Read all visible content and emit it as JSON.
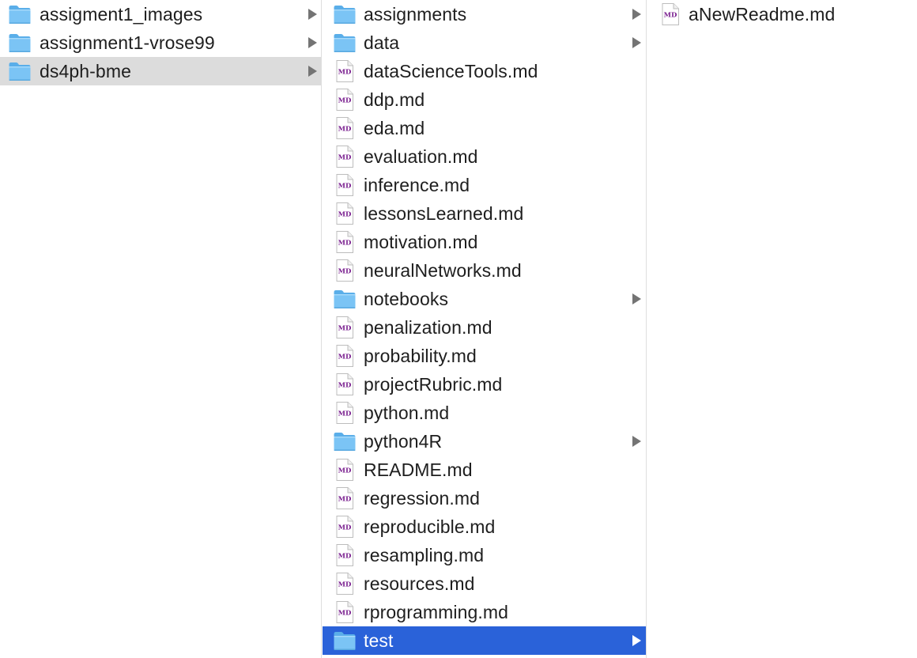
{
  "colors": {
    "active_selection": "#2a62d9",
    "inactive_selection": "#dcdcdc",
    "folder_blue": "#72c2f4",
    "md_badge": "#7a1f8f"
  },
  "columns": [
    {
      "name": "column-1",
      "items": [
        {
          "label": "assigment1_images",
          "kind": "folder",
          "selected": "none"
        },
        {
          "label": "assignment1-vrose99",
          "kind": "folder",
          "selected": "none"
        },
        {
          "label": "ds4ph-bme",
          "kind": "folder",
          "selected": "inactive"
        }
      ]
    },
    {
      "name": "column-2",
      "items": [
        {
          "label": "assignments",
          "kind": "folder",
          "selected": "none"
        },
        {
          "label": "data",
          "kind": "folder",
          "selected": "none"
        },
        {
          "label": "dataScienceTools.md",
          "kind": "md",
          "selected": "none"
        },
        {
          "label": "ddp.md",
          "kind": "md",
          "selected": "none"
        },
        {
          "label": "eda.md",
          "kind": "md",
          "selected": "none"
        },
        {
          "label": "evaluation.md",
          "kind": "md",
          "selected": "none"
        },
        {
          "label": "inference.md",
          "kind": "md",
          "selected": "none"
        },
        {
          "label": "lessonsLearned.md",
          "kind": "md",
          "selected": "none"
        },
        {
          "label": "motivation.md",
          "kind": "md",
          "selected": "none"
        },
        {
          "label": "neuralNetworks.md",
          "kind": "md",
          "selected": "none"
        },
        {
          "label": "notebooks",
          "kind": "folder",
          "selected": "none"
        },
        {
          "label": "penalization.md",
          "kind": "md",
          "selected": "none"
        },
        {
          "label": "probability.md",
          "kind": "md",
          "selected": "none"
        },
        {
          "label": "projectRubric.md",
          "kind": "md",
          "selected": "none"
        },
        {
          "label": "python.md",
          "kind": "md",
          "selected": "none"
        },
        {
          "label": "python4R",
          "kind": "folder",
          "selected": "none"
        },
        {
          "label": "README.md",
          "kind": "md",
          "selected": "none"
        },
        {
          "label": "regression.md",
          "kind": "md",
          "selected": "none"
        },
        {
          "label": "reproducible.md",
          "kind": "md",
          "selected": "none"
        },
        {
          "label": "resampling.md",
          "kind": "md",
          "selected": "none"
        },
        {
          "label": "resources.md",
          "kind": "md",
          "selected": "none"
        },
        {
          "label": "rprogramming.md",
          "kind": "md",
          "selected": "none"
        },
        {
          "label": "test",
          "kind": "folder",
          "selected": "active"
        }
      ]
    },
    {
      "name": "column-3",
      "items": [
        {
          "label": "aNewReadme.md",
          "kind": "md",
          "selected": "none"
        }
      ]
    }
  ],
  "icons": {
    "folder": "folder-icon",
    "md": "markdown-file-icon",
    "disclosure": "chevron-right-icon",
    "md_badge_text": "MD"
  }
}
